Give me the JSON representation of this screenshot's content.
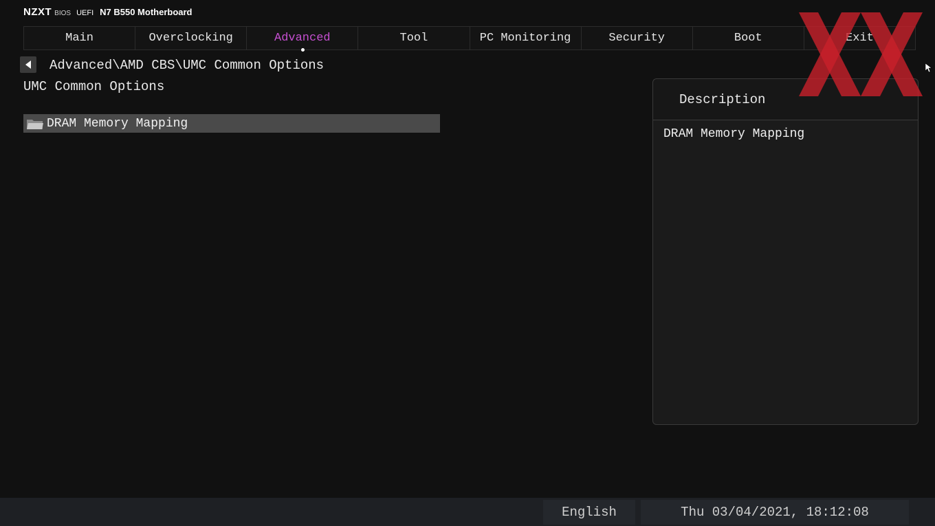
{
  "brand": {
    "logo": "NZXT",
    "bios": "BIOS",
    "uefi": "UEFI",
    "model": "N7 B550 Motherboard"
  },
  "tabs": [
    {
      "label": "Main"
    },
    {
      "label": "Overclocking"
    },
    {
      "label": "Advanced",
      "active": true
    },
    {
      "label": "Tool"
    },
    {
      "label": "PC Monitoring"
    },
    {
      "label": "Security"
    },
    {
      "label": "Boot"
    },
    {
      "label": "Exit"
    }
  ],
  "breadcrumb": "Advanced\\AMD CBS\\UMC Common Options",
  "page_title": "UMC Common Options",
  "menu": {
    "items": [
      {
        "label": "DRAM Memory Mapping",
        "icon": "folder-icon",
        "selected": true
      }
    ]
  },
  "description": {
    "title": "Description",
    "text": "DRAM Memory Mapping"
  },
  "footer": {
    "language": "English",
    "datetime": "Thu 03/04/2021, 18:12:08"
  },
  "colors": {
    "background": "#111111",
    "active_tab": "#c54fd0",
    "selected_row": "#4a4a4a",
    "watermark": "#c8202a"
  }
}
